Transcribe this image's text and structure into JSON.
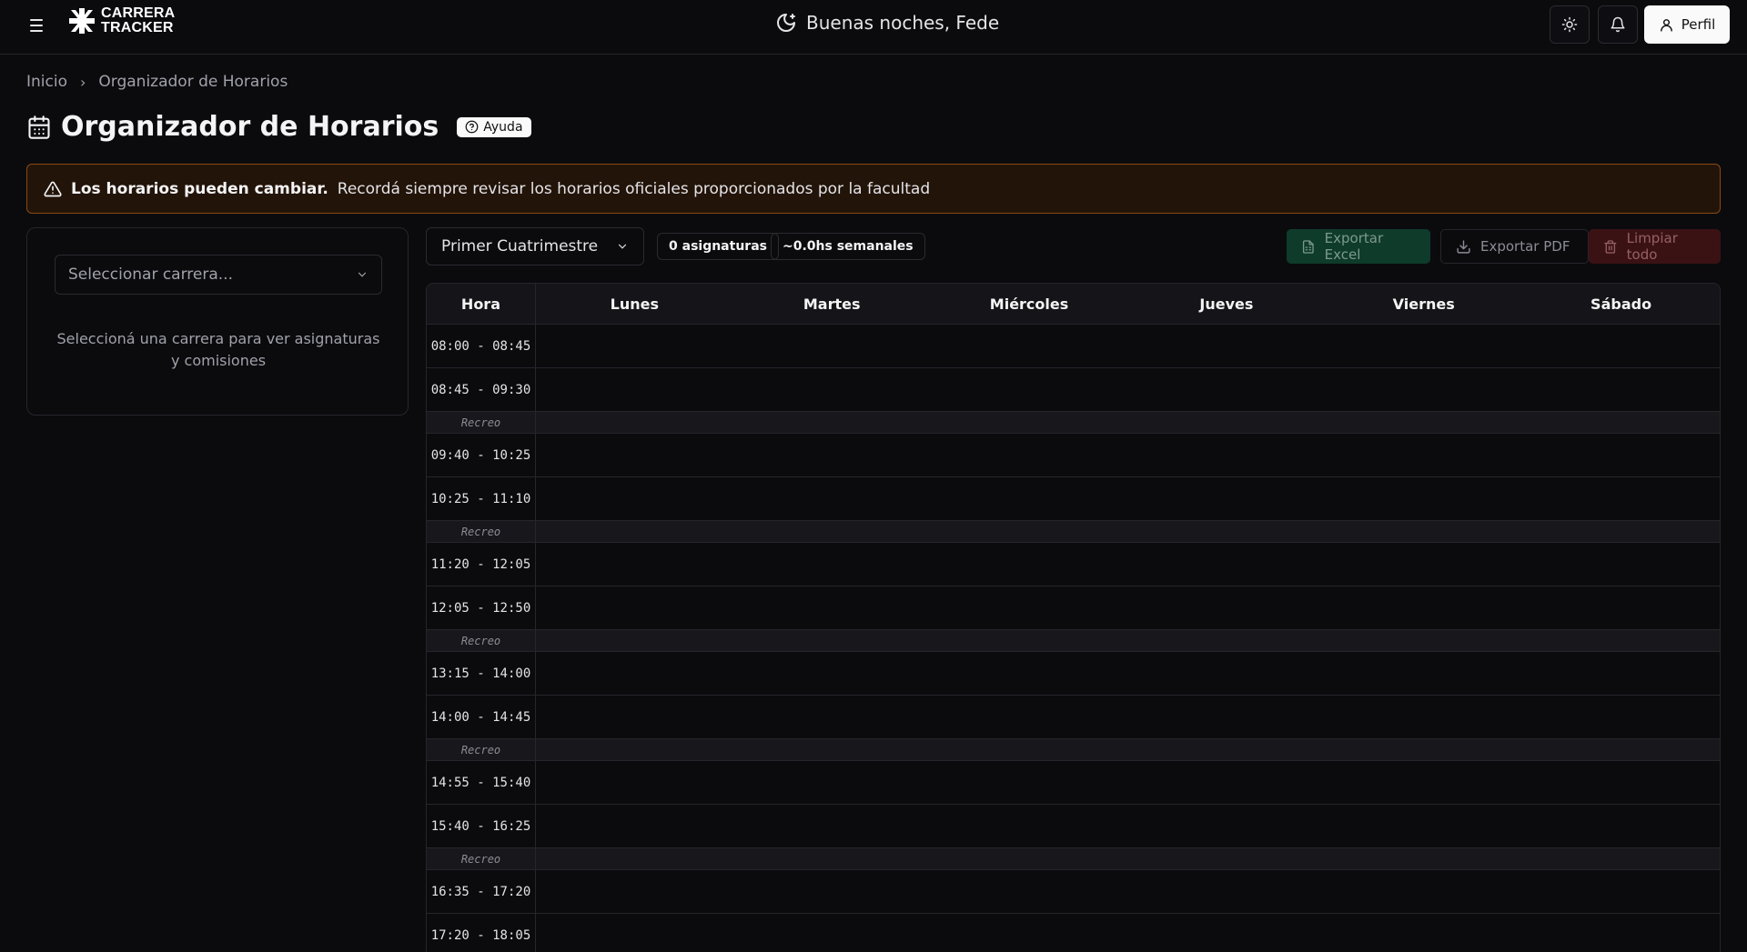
{
  "header": {
    "logo_line1": "CARRERA",
    "logo_line2": "TRACKER",
    "greeting": "Buenas noches, Fede",
    "profile_label": "Perfil"
  },
  "breadcrumb": {
    "home": "Inicio",
    "current": "Organizador de Horarios"
  },
  "page": {
    "title": "Organizador de Horarios",
    "help_label": "Ayuda"
  },
  "alert": {
    "strong": "Los horarios pueden cambiar.",
    "text": "Recordá siempre revisar los horarios oficiales proporcionados por la facultad"
  },
  "sidebar": {
    "career_placeholder": "Seleccionar carrera...",
    "empty_message": "Seleccioná una carrera para ver asignaturas y comisiones"
  },
  "toolbar": {
    "term": "Primer Cuatrimestre",
    "subjects_count": "0 asignaturas",
    "weekly_hours": "~0.0hs semanales",
    "export_excel": "Exportar Excel",
    "export_pdf": "Exportar PDF",
    "clear_all": "Limpiar todo"
  },
  "schedule": {
    "hour_header": "Hora",
    "days": [
      "Lunes",
      "Martes",
      "Miércoles",
      "Jueves",
      "Viernes",
      "Sábado"
    ],
    "rows": [
      {
        "type": "slot",
        "label": "08:00 - 08:45"
      },
      {
        "type": "slot",
        "label": "08:45 - 09:30"
      },
      {
        "type": "break",
        "label": "Recreo"
      },
      {
        "type": "slot",
        "label": "09:40 - 10:25"
      },
      {
        "type": "slot",
        "label": "10:25 - 11:10"
      },
      {
        "type": "break",
        "label": "Recreo"
      },
      {
        "type": "slot",
        "label": "11:20 - 12:05"
      },
      {
        "type": "slot",
        "label": "12:05 - 12:50"
      },
      {
        "type": "break",
        "label": "Recreo"
      },
      {
        "type": "slot",
        "label": "13:15 - 14:00"
      },
      {
        "type": "slot",
        "label": "14:00 - 14:45"
      },
      {
        "type": "break",
        "label": "Recreo"
      },
      {
        "type": "slot",
        "label": "14:55 - 15:40"
      },
      {
        "type": "slot",
        "label": "15:40 - 16:25"
      },
      {
        "type": "break",
        "label": "Recreo"
      },
      {
        "type": "slot",
        "label": "16:35 - 17:20"
      },
      {
        "type": "slot",
        "label": "17:20 - 18:05"
      }
    ]
  },
  "icons": {
    "menu": "hamburger-icon",
    "logo": "utn-logo-icon",
    "greeting": "moon-icon",
    "theme": "sun-icon",
    "notifications": "bell-icon",
    "profile": "user-icon",
    "title": "calendar-icon",
    "help": "question-circle-icon",
    "alert": "warning-triangle-icon",
    "excel": "file-spreadsheet-icon",
    "pdf": "download-icon",
    "clear": "trash-icon"
  },
  "colors": {
    "background": "#0b0b0e",
    "alert_border": "#8a4a12",
    "alert_bg": "#231409",
    "excel_bg": "#0f3b2a",
    "clear_bg": "#3b1214"
  }
}
